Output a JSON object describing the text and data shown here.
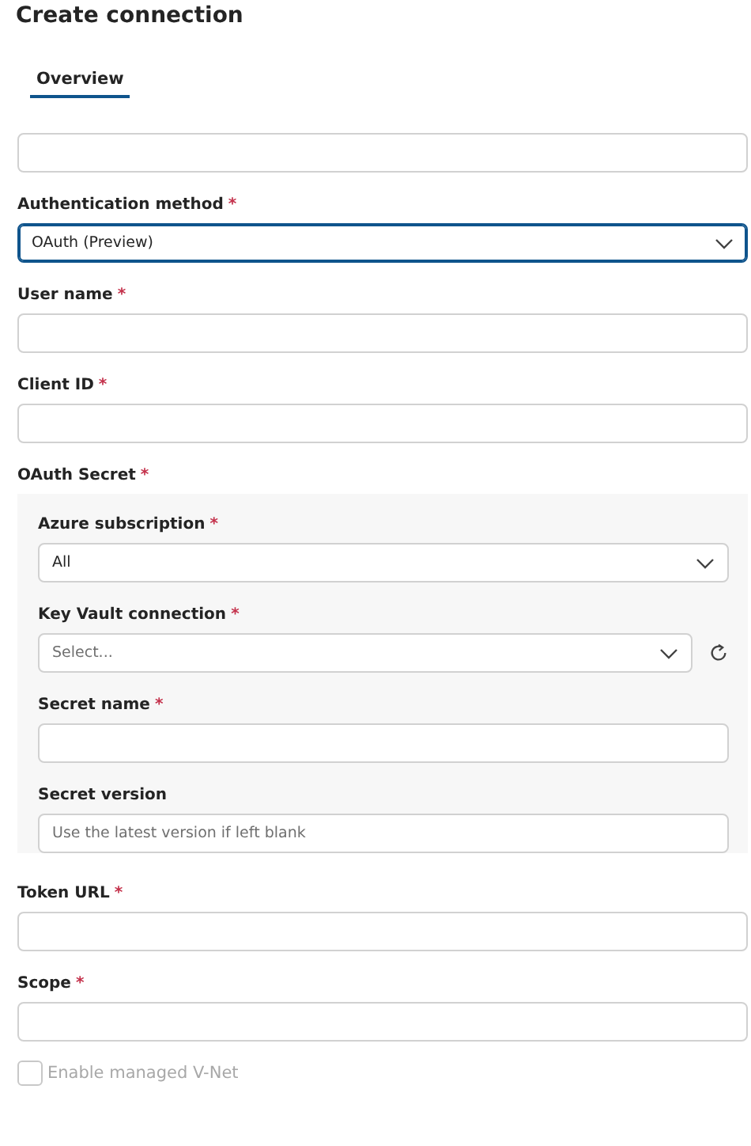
{
  "title": "Create connection",
  "tabs": [
    {
      "label": "Overview",
      "selected": true
    }
  ],
  "fields": [
    {
      "kind": "text"
    },
    {
      "kind": "select",
      "label": "Authentication method",
      "required_mark": "*",
      "value": "OAuth (Preview)",
      "focused": true
    },
    {
      "kind": "text",
      "label": "User name",
      "required_mark": "*"
    },
    {
      "kind": "text",
      "label": "Client ID",
      "required_mark": "*"
    },
    {
      "kind": "group",
      "label": "OAuth Secret",
      "required_mark": "*",
      "children": [
        {
          "kind": "select",
          "label": "Azure subscription",
          "required_mark": "*",
          "value": "All"
        },
        {
          "kind": "select",
          "label": "Key Vault connection",
          "required_mark": "*",
          "placeholder": "Select...",
          "refresh": true
        },
        {
          "kind": "text",
          "label": "Secret name",
          "required_mark": "*"
        },
        {
          "kind": "text",
          "label": "Secret version",
          "placeholder": "Use the latest version if left blank"
        }
      ]
    },
    {
      "kind": "text",
      "label": "Token URL",
      "required_mark": "*"
    },
    {
      "kind": "text",
      "label": "Scope",
      "required_mark": "*"
    }
  ],
  "checkbox": {
    "label": "Enable managed V-Net",
    "checked": false,
    "disabled": true
  }
}
